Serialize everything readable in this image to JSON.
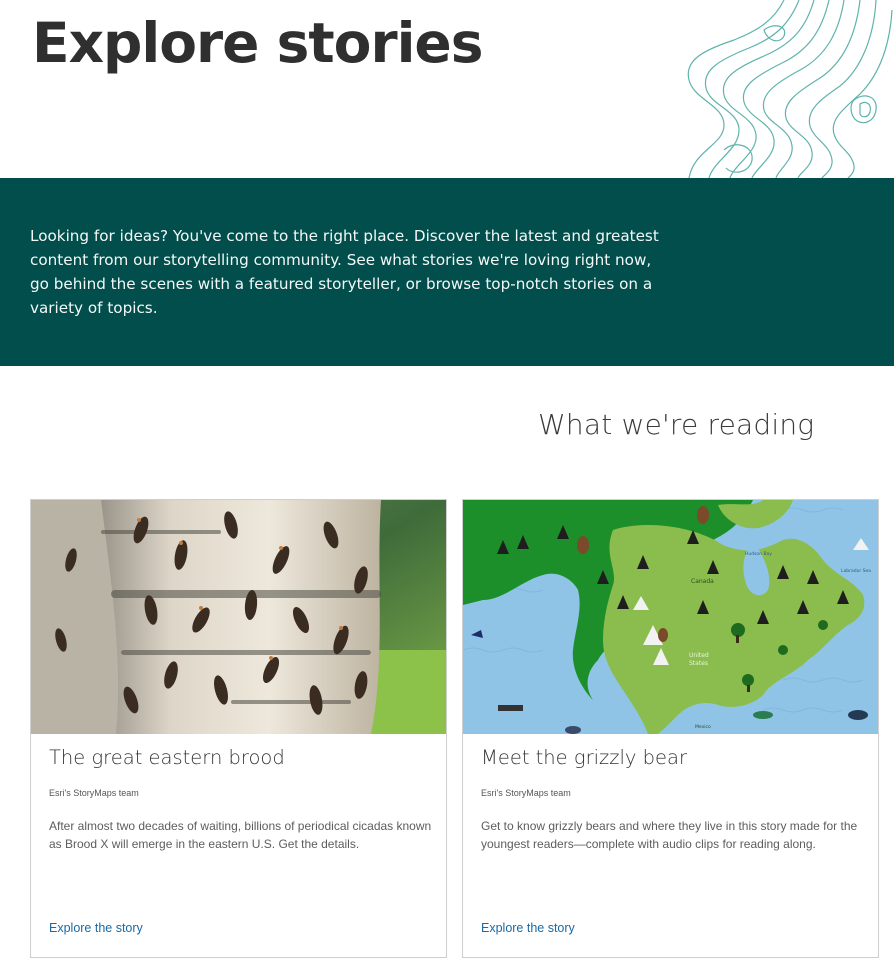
{
  "header": {
    "title": "Explore stories"
  },
  "intro": {
    "text": "Looking for ideas? You've come to the right place. Discover the latest and greatest content from our storytelling community. See what stories we're loving right now, go behind the scenes with a featured storyteller, or browse top-notch stories on a variety of topics."
  },
  "reading": {
    "heading": "What we're reading",
    "cards": [
      {
        "image_name": "cicada-on-birch-tree-photo",
        "title": "The great eastern brood",
        "author": "Esri's StoryMaps team",
        "description": "After almost two decades of waiting, billions of periodical cicadas known as Brood X will emerge in the eastern U.S. Get the details.",
        "link_label": "Explore the story"
      },
      {
        "image_name": "north-america-illustrated-map",
        "title": "Meet the grizzly bear",
        "author": "Esri's StoryMaps team",
        "description": "Get to know grizzly bears and where they live in this story made for the youngest readers—complete with audio clips for reading along.",
        "link_label": "Explore the story",
        "map_labels": {
          "canada": "Canada",
          "us_line1": "United",
          "us_line2": "States",
          "hudson": "Hudson Bay",
          "labrador": "Labrador Sea",
          "mexico": "Mexico"
        }
      }
    ]
  },
  "colors": {
    "band": "#014e4c",
    "link": "#1a6aa3",
    "contour": "#5fb3ad"
  }
}
